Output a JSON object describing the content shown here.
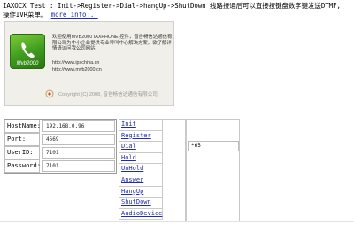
{
  "intro": {
    "line1": "IAXOCX Test : Init->Register->Dial->hangUp->ShutDown 线路接通后可以直接按键盘数字键发送DTMF,",
    "line2": "操作IVR菜单。",
    "more_link": "more info..."
  },
  "banner": {
    "logo_text": "Mvb2000",
    "desc": "欢迎使用MVB2000 IAXPHONE 控件，音告畅信达通信有限公司为中小企业提供专业呼叫中心解决方案。欲了解详情请访问我公司网站:",
    "link1": "http://www.ipxchina.cn",
    "link2": "http://www.mvb2000.cn",
    "copyright": "Copyright (C) 2008, 音告畅信达通信有限公司"
  },
  "form": {
    "host_label": "HostName:",
    "host_value": "192.168.0.96",
    "port_label": "Port:",
    "port_value": "4569",
    "user_label": "UserID:",
    "user_value": "7101",
    "pass_label": "Password:",
    "pass_value": "7101"
  },
  "buttons": [
    "Init",
    "Register",
    "Dial",
    "Hold",
    "UnHold",
    "Answer",
    "HangUp",
    "ShutDown",
    "AudioDevice"
  ],
  "dial_value": "*65"
}
